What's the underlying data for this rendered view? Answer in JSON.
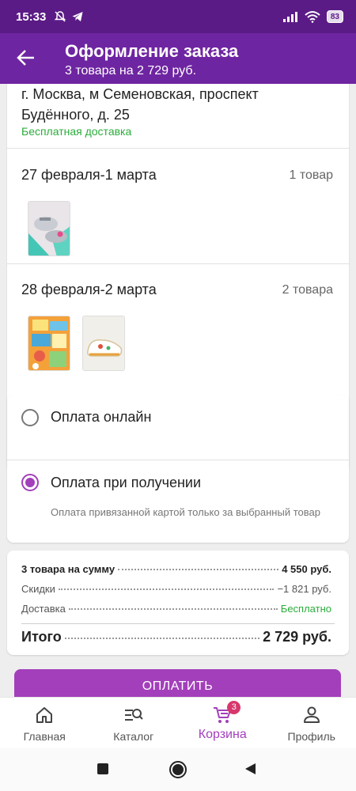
{
  "status_bar": {
    "time": "15:33",
    "battery": "83",
    "icons": [
      "mute-icon",
      "telegram-icon",
      "signal-icon",
      "wifi-icon",
      "battery-icon"
    ]
  },
  "header": {
    "title": "Оформление заказа",
    "subtitle": "3 товара на 2 729 руб.",
    "background": "#6e25a1"
  },
  "delivery": {
    "address": "г. Москва, м Семеновская, проспект Будённого, д. 25",
    "shipping_note": "Бесплатная доставка",
    "groups": [
      {
        "date": "27 февраля-1 марта",
        "count": "1 товар",
        "items": [
          "sandals-thumbnail"
        ]
      },
      {
        "date": "28 февраля-2 марта",
        "count": "2 товара",
        "items": [
          "stickers-thumbnail",
          "sneakers-thumbnail"
        ]
      }
    ]
  },
  "payment": {
    "options": [
      {
        "label": "Оплата онлайн",
        "selected": false
      },
      {
        "label": "Оплата при получении",
        "selected": true,
        "note": "Оплата привязанной картой только за выбранный товар"
      }
    ],
    "accent": "#a33fbb"
  },
  "summary": {
    "subtotal_label": "3 товара на сумму",
    "subtotal_value": "4 550 руб.",
    "discount_label": "Скидки",
    "discount_value": "−1 821 руб.",
    "delivery_label": "Доставка",
    "delivery_value": "Бесплатно",
    "total_label": "Итого",
    "total_value": "2 729 руб."
  },
  "pay_button": {
    "label": "ОПЛАТИТЬ"
  },
  "bottom_nav": {
    "items": [
      {
        "label": "Главная",
        "icon": "home-icon"
      },
      {
        "label": "Каталог",
        "icon": "catalog-search-icon"
      },
      {
        "label": "Корзина",
        "icon": "cart-icon",
        "badge": "3",
        "active": true
      },
      {
        "label": "Профиль",
        "icon": "profile-icon"
      }
    ]
  },
  "system_nav": [
    "recents-square-icon",
    "home-circle-icon",
    "back-triangle-icon"
  ]
}
